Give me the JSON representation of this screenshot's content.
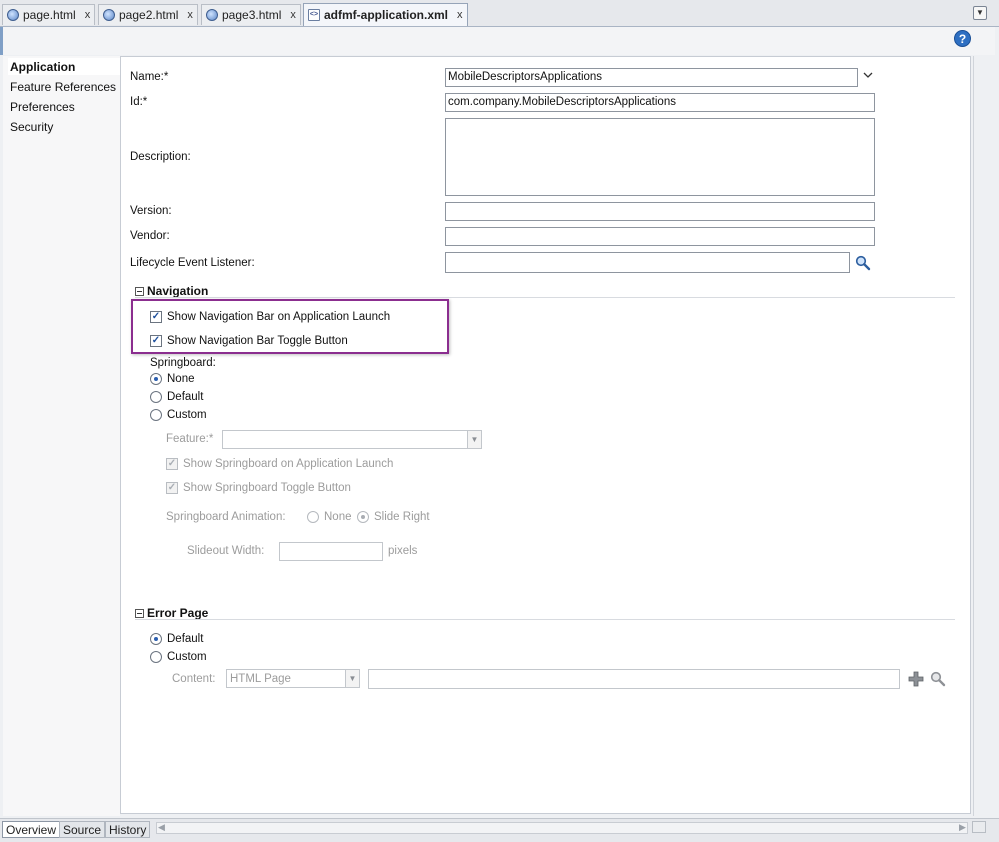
{
  "tabs": [
    {
      "label": "page.html",
      "icon": "html-file-icon"
    },
    {
      "label": "page2.html",
      "icon": "html-file-icon"
    },
    {
      "label": "page3.html",
      "icon": "html-file-icon"
    },
    {
      "label": "adfmf-application.xml",
      "icon": "xml-file-icon",
      "active": true
    }
  ],
  "tab_close_glyph": "x",
  "help_label": "?",
  "sidebar": {
    "items": [
      "Application",
      "Feature References",
      "Preferences",
      "Security"
    ],
    "selected": "Application"
  },
  "form": {
    "name_label": "Name:*",
    "name_value": "MobileDescriptorsApplications",
    "id_label": "Id:*",
    "id_value": "com.company.MobileDescriptorsApplications",
    "description_label": "Description:",
    "description_value": "",
    "version_label": "Version:",
    "version_value": "",
    "vendor_label": "Vendor:",
    "vendor_value": "",
    "lifecycle_label": "Lifecycle Event Listener:",
    "lifecycle_value": ""
  },
  "navigation": {
    "header": "Navigation",
    "show_navbar_label": "Show Navigation Bar on Application Launch",
    "show_navbar_checked": true,
    "show_toggle_label": "Show Navigation Bar Toggle Button",
    "show_toggle_checked": true,
    "springboard_label": "Springboard:",
    "springboard_options": [
      "None",
      "Default",
      "Custom"
    ],
    "springboard_selected": "None",
    "feature_label": "Feature:*",
    "feature_value": "",
    "show_springboard_launch_label": "Show Springboard on Application Launch",
    "show_springboard_toggle_label": "Show Springboard Toggle Button",
    "animation_label": "Springboard Animation:",
    "animation_options": [
      "None",
      "Slide Right"
    ],
    "animation_selected": "Slide Right",
    "slideout_label": "Slideout Width:",
    "slideout_value": "",
    "slideout_unit": "pixels"
  },
  "error_page": {
    "header": "Error Page",
    "options": [
      "Default",
      "Custom"
    ],
    "selected": "Default",
    "content_label": "Content:",
    "content_type": "HTML Page",
    "content_value": ""
  },
  "bottom_tabs": [
    "Overview",
    "Source",
    "History"
  ],
  "bottom_active": "Overview",
  "colors": {
    "highlight_border": "#8b2e8f",
    "accent": "#2e6fc2"
  }
}
